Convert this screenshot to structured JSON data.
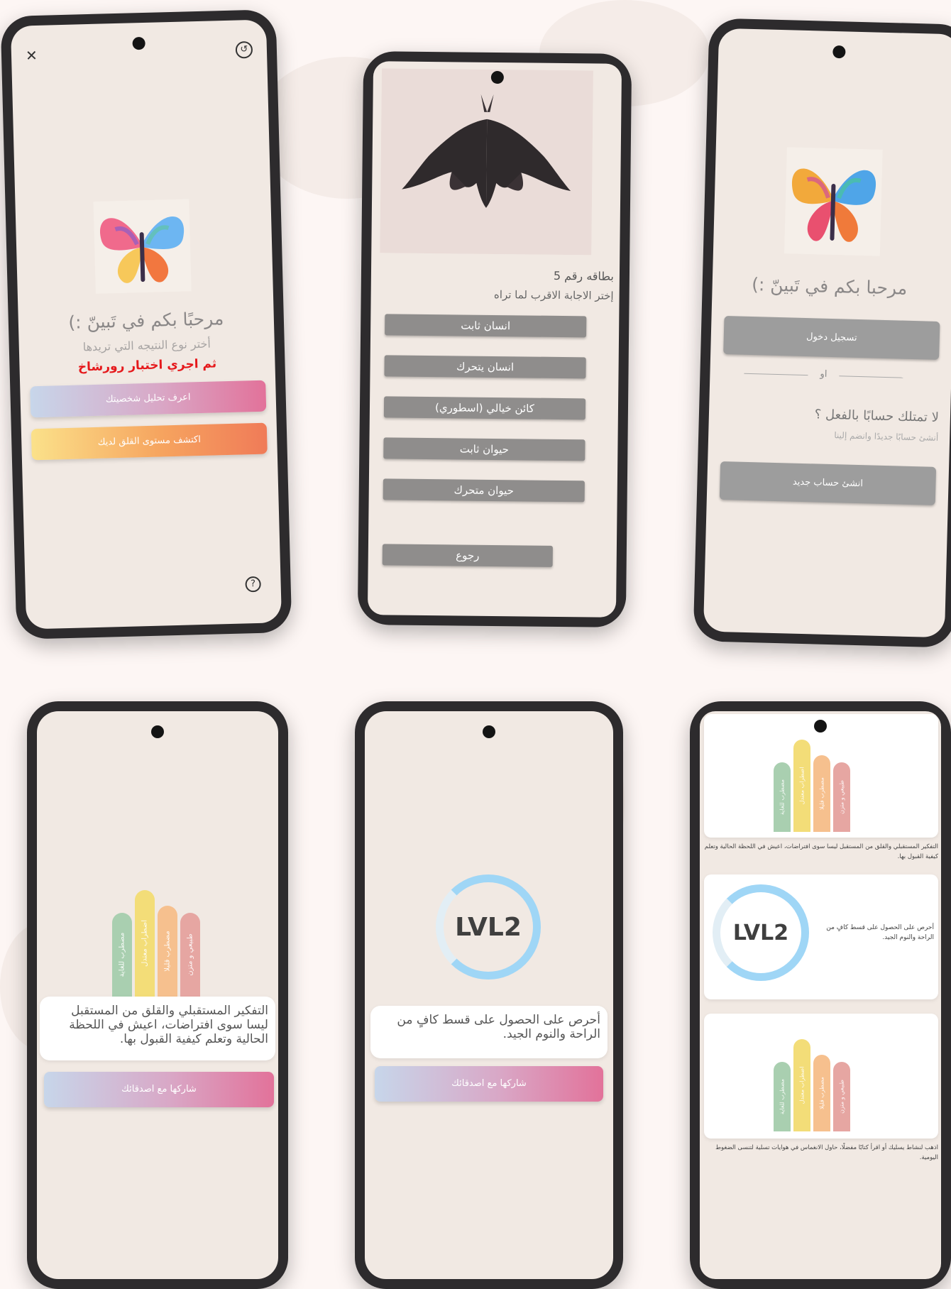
{
  "icons": {
    "close": "✕",
    "history": "↺",
    "help": "?"
  },
  "welcome_screen": {
    "title": "مرحبًا بكم في تَبينّ :)",
    "subtitle": "أختر نوع النتيجه التي تريدها",
    "instruction": "ثم اجري اختبار رورشاخ",
    "personality_button": "اعرف تحليل شخصيتك",
    "anxiety_button": "اكتشف مستوى القلق لديك"
  },
  "card_screen": {
    "card_number": "بطاقه رقم 5",
    "question": "إختر الاجابة الاقرب لما تراه",
    "options": [
      "انسان ثابت",
      "انسان يتحرك",
      "كائن خيالي (اسطوري)",
      "حيوان ثابت",
      "حيوان متحرك"
    ],
    "back_button": "رجوع"
  },
  "login_screen": {
    "title": "مرحبا بكم في تَبينّ :)",
    "login_button": "تسجيل دخول",
    "or_label": "او",
    "no_account": "لا تمتلك حسابًا بالفعل ؟",
    "no_account_hint": "أنشئ حسابًا جديدًا وانضم إلينا",
    "signup_button": "انشئ حساب جديد"
  },
  "anxiety_result": {
    "bars": [
      "مضطرب للغاية",
      "اضطراب معتدل",
      "مضطرب قليلا",
      "طبيعي و متزن"
    ],
    "advice": "التفكير المستقبلي والقلق من المستقبل ليسا سوى افتراضات، اعيش في اللحظة الحالية وتعلم كيفية القبول بها.",
    "share_button": "شاركها مع اصدقائك"
  },
  "level_result": {
    "level": "LVL2",
    "advice": "أحرص على الحصول على قسط كافٍ من الراحة والنوم الجيد.",
    "share_button": "شاركها مع اصدقائك"
  },
  "history_screen": {
    "bars": [
      "مضطرب للغاية",
      "اضطراب معتدل",
      "مضطرب قليلا",
      "طبيعي و متزن"
    ],
    "bars_second": [
      "مضطرب للغاية",
      "اضطراب معتدل",
      "مضطرب قليلا",
      "طبيعي و متزن"
    ],
    "entry1": "التفكير المستقبلي والقلق من المستقبل ليسا سوى افتراضات، اعيش في اللحظة الحالية وتعلم كيفية القبول بها.",
    "level": "LVL2",
    "entry2": "أحرص على الحصول على قسط كافٍ من الراحة والنوم الجيد.",
    "entry3": "اذهب لنشاط يسليك أو اقرأ كتابًا مفضلًا، حاول الانغماس في هوايات تسلية لتنسى الضغوط اليومية."
  },
  "colors": {
    "bar_green": "#a9cfb0",
    "bar_yellow": "#f3dd78",
    "bar_orange": "#f6c08e",
    "bar_rose": "#e6a6a2",
    "accent_red": "#e5191c",
    "ring_blue": "#9fd6f6"
  }
}
